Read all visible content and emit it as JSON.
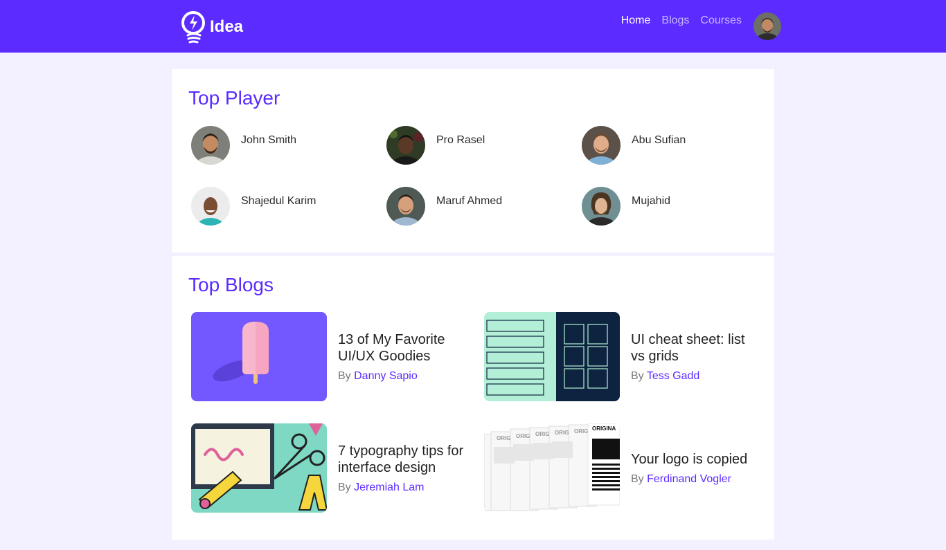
{
  "header": {
    "brand": "Idea",
    "nav": [
      {
        "label": "Home",
        "active": true
      },
      {
        "label": "Blogs",
        "active": false
      },
      {
        "label": "Courses",
        "active": false
      }
    ],
    "accent": "#5b2bff"
  },
  "top_player": {
    "title": "Top Player",
    "players": [
      {
        "name": "John Smith"
      },
      {
        "name": "Pro Rasel"
      },
      {
        "name": "Abu Sufian"
      },
      {
        "name": "Shajedul Karim"
      },
      {
        "name": "Maruf Ahmed"
      },
      {
        "name": "Mujahid"
      }
    ]
  },
  "top_blogs": {
    "title": "Top Blogs",
    "by_label": "By",
    "blogs": [
      {
        "title": "13 of My Favorite UI/UX Goodies",
        "author": "Danny Sapio"
      },
      {
        "title": "UI cheat sheet: list vs grids",
        "author": "Tess Gadd"
      },
      {
        "title": "7 typography tips for interface design",
        "author": "Jeremiah Lam"
      },
      {
        "title": "Your logo is copied",
        "author": "Ferdinand Vogler"
      }
    ],
    "thumb_text": "ORIGINA"
  }
}
